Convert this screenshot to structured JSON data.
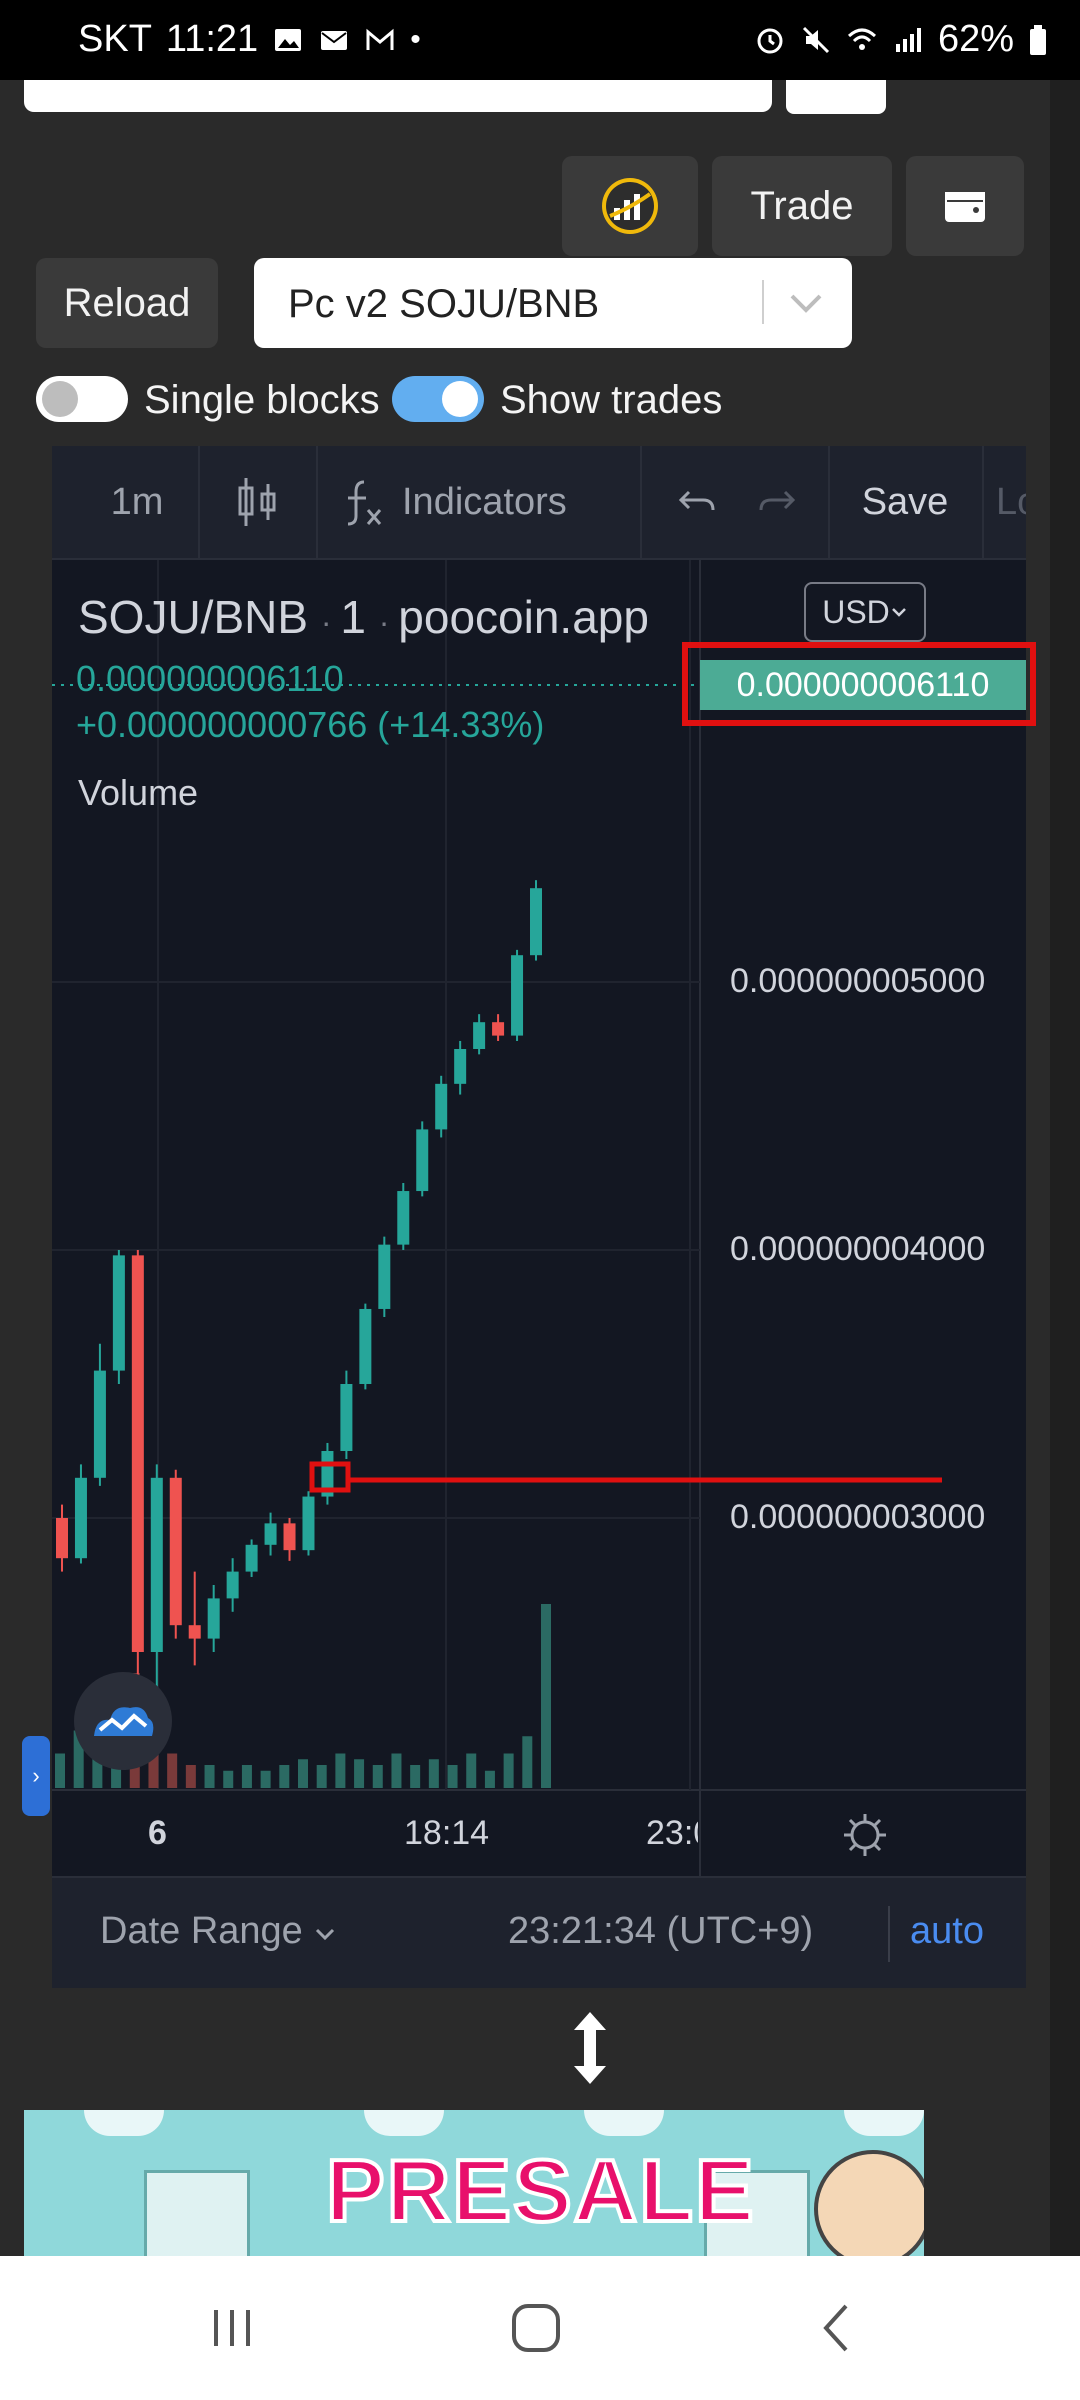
{
  "status_bar": {
    "carrier": "SKT",
    "time": "11:21",
    "battery": "62%",
    "icons": [
      "image-icon",
      "mail-icon",
      "gmail-icon",
      "dot-icon",
      "alarm-icon",
      "mute-icon",
      "wifi-icon",
      "signal-icon",
      "battery-icon"
    ]
  },
  "header": {
    "trade_label": "Trade",
    "reload_label": "Reload",
    "pair_select_value": "Pc v2 SOJU/BNB"
  },
  "toggles": {
    "single_blocks_label": "Single blocks",
    "single_blocks_on": false,
    "show_trades_label": "Show trades",
    "show_trades_on": true
  },
  "chart_toolbar": {
    "interval": "1m",
    "indicators_label": "Indicators",
    "save_label": "Save",
    "load_label": "Lo"
  },
  "chart_legend": {
    "symbol": "SOJU/BNB",
    "interval": "1",
    "source": "poocoin.app",
    "last_price": "0.000000006110",
    "change": "+0.000000000766 (+14.33%)",
    "volume_label": "Volume",
    "currency": "USD"
  },
  "chart_data": {
    "type": "candlestick",
    "price_axis_ticks": [
      "0.000000005000",
      "0.000000004000",
      "0.000000003000"
    ],
    "price_tag": "0.000000006110",
    "time_axis_ticks": [
      "6",
      "18:14",
      "23:0"
    ],
    "ylim": [
      2.2e-09,
      6.4e-09
    ],
    "grid": true,
    "up_color": "#26a69a",
    "down_color": "#ef5350",
    "candles": [
      {
        "o": 3.0,
        "h": 3.05,
        "l": 2.8,
        "c": 2.85
      },
      {
        "o": 2.85,
        "h": 3.2,
        "l": 2.83,
        "c": 3.15
      },
      {
        "o": 3.15,
        "h": 3.65,
        "l": 3.12,
        "c": 3.55
      },
      {
        "o": 3.55,
        "h": 4.0,
        "l": 3.5,
        "c": 3.98
      },
      {
        "o": 3.98,
        "h": 4.0,
        "l": 2.4,
        "c": 2.5
      },
      {
        "o": 2.5,
        "h": 3.2,
        "l": 2.3,
        "c": 3.15
      },
      {
        "o": 3.15,
        "h": 3.18,
        "l": 2.55,
        "c": 2.6
      },
      {
        "o": 2.6,
        "h": 2.8,
        "l": 2.45,
        "c": 2.55
      },
      {
        "o": 2.55,
        "h": 2.75,
        "l": 2.5,
        "c": 2.7
      },
      {
        "o": 2.7,
        "h": 2.85,
        "l": 2.65,
        "c": 2.8
      },
      {
        "o": 2.8,
        "h": 2.92,
        "l": 2.78,
        "c": 2.9
      },
      {
        "o": 2.9,
        "h": 3.02,
        "l": 2.86,
        "c": 2.98
      },
      {
        "o": 2.98,
        "h": 3.0,
        "l": 2.84,
        "c": 2.88
      },
      {
        "o": 2.88,
        "h": 3.1,
        "l": 2.86,
        "c": 3.08
      },
      {
        "o": 3.08,
        "h": 3.28,
        "l": 3.05,
        "c": 3.25
      },
      {
        "o": 3.25,
        "h": 3.55,
        "l": 3.22,
        "c": 3.5
      },
      {
        "o": 3.5,
        "h": 3.8,
        "l": 3.48,
        "c": 3.78
      },
      {
        "o": 3.78,
        "h": 4.05,
        "l": 3.75,
        "c": 4.02
      },
      {
        "o": 4.02,
        "h": 4.25,
        "l": 4.0,
        "c": 4.22
      },
      {
        "o": 4.22,
        "h": 4.48,
        "l": 4.2,
        "c": 4.45
      },
      {
        "o": 4.45,
        "h": 4.65,
        "l": 4.42,
        "c": 4.62
      },
      {
        "o": 4.62,
        "h": 4.78,
        "l": 4.58,
        "c": 4.75
      },
      {
        "o": 4.75,
        "h": 4.88,
        "l": 4.73,
        "c": 4.85
      },
      {
        "o": 4.85,
        "h": 4.88,
        "l": 4.78,
        "c": 4.8
      },
      {
        "o": 4.8,
        "h": 5.12,
        "l": 4.78,
        "c": 5.1
      },
      {
        "o": 5.1,
        "h": 5.38,
        "l": 5.08,
        "c": 5.35
      }
    ],
    "volume": [
      0.3,
      0.5,
      0.4,
      0.6,
      1.0,
      0.5,
      0.3,
      0.2,
      0.2,
      0.15,
      0.2,
      0.15,
      0.2,
      0.25,
      0.2,
      0.3,
      0.25,
      0.2,
      0.3,
      0.2,
      0.25,
      0.2,
      0.3,
      0.15,
      0.3,
      0.45,
      1.6
    ]
  },
  "date_range_bar": {
    "date_range_label": "Date Range",
    "clock": "23:21:34 (UTC+9)",
    "auto_label": "auto"
  },
  "annotations": {
    "highlight_color": "#e01010"
  },
  "banner": {
    "text": "PRESALE"
  }
}
